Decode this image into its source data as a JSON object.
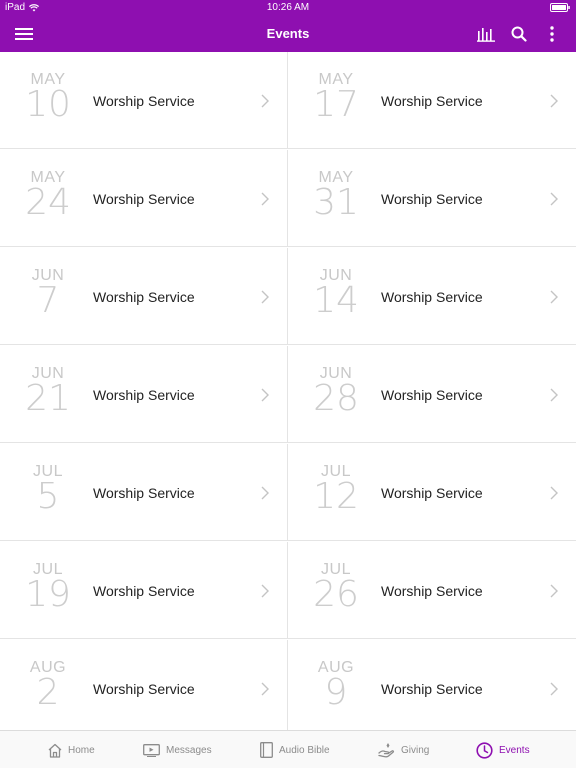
{
  "status_bar": {
    "carrier": "iPad",
    "time": "10:26 AM"
  },
  "header": {
    "title": "Events"
  },
  "events": [
    {
      "month": "MAY",
      "day": "10",
      "title": "Worship Service"
    },
    {
      "month": "MAY",
      "day": "17",
      "title": "Worship Service"
    },
    {
      "month": "MAY",
      "day": "24",
      "title": "Worship Service"
    },
    {
      "month": "MAY",
      "day": "31",
      "title": "Worship Service"
    },
    {
      "month": "JUN",
      "day": "7",
      "title": "Worship Service"
    },
    {
      "month": "JUN",
      "day": "14",
      "title": "Worship Service"
    },
    {
      "month": "JUN",
      "day": "21",
      "title": "Worship Service"
    },
    {
      "month": "JUN",
      "day": "28",
      "title": "Worship Service"
    },
    {
      "month": "JUL",
      "day": "5",
      "title": "Worship Service"
    },
    {
      "month": "JUL",
      "day": "12",
      "title": "Worship Service"
    },
    {
      "month": "JUL",
      "day": "19",
      "title": "Worship Service"
    },
    {
      "month": "JUL",
      "day": "26",
      "title": "Worship Service"
    },
    {
      "month": "AUG",
      "day": "2",
      "title": "Worship Service"
    },
    {
      "month": "AUG",
      "day": "9",
      "title": "Worship Service"
    }
  ],
  "tabs": [
    {
      "label": "Home",
      "icon": "home-icon"
    },
    {
      "label": "Messages",
      "icon": "video-icon"
    },
    {
      "label": "Audio Bible",
      "icon": "book-icon"
    },
    {
      "label": "Giving",
      "icon": "giving-hand-icon"
    },
    {
      "label": "Events",
      "icon": "clock-icon",
      "active": true
    }
  ],
  "colors": {
    "accent": "#8e0fb0",
    "date_text": "#c8c8c8",
    "divider": "#e4e4e4"
  }
}
